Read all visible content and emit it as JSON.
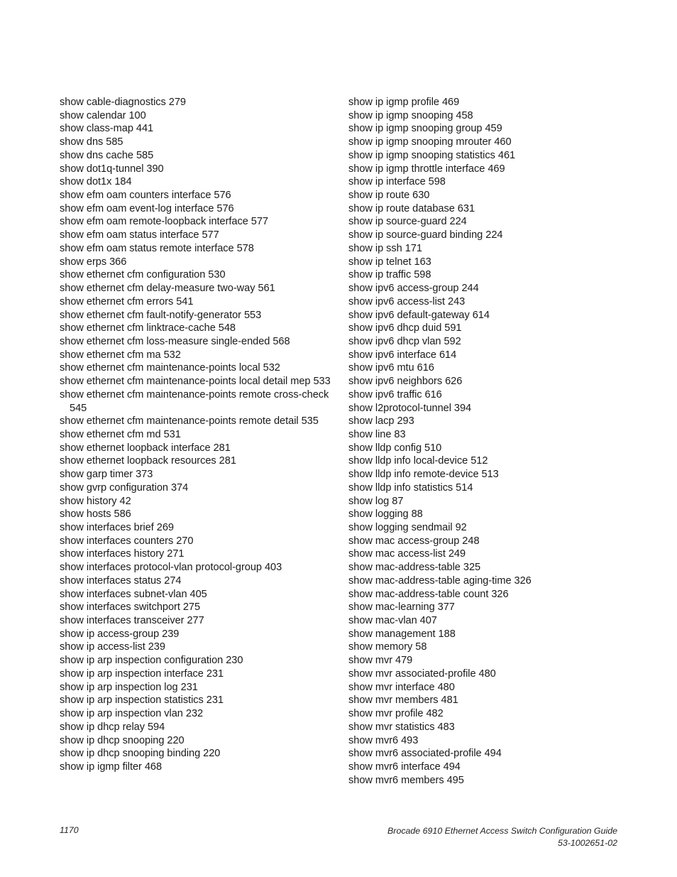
{
  "index": {
    "left_column": [
      "show cable-diagnostics 279",
      "show calendar 100",
      "show class-map 441",
      "show dns 585",
      "show dns cache 585",
      "show dot1q-tunnel 390",
      "show dot1x 184",
      "show efm oam counters interface  576",
      "show efm oam event-log interface  576",
      "show efm oam remote-loopback interface 577",
      "show efm oam status interface 577",
      "show efm oam status remote interface  578",
      "show erps 366",
      "show ethernet cfm configuration 530",
      "show ethernet cfm delay-measure two-way 561",
      "show ethernet cfm errors 541",
      "show ethernet cfm fault-notify-generator 553",
      "show ethernet cfm linktrace-cache 548",
      "show ethernet cfm loss-measure single-ended 568",
      "show ethernet cfm ma 532",
      "show ethernet cfm maintenance-points local 532",
      "show ethernet cfm maintenance-points local detail mep 533",
      "show ethernet cfm maintenance-points remote cross-check 545",
      "show ethernet cfm maintenance-points remote detail 535",
      "show ethernet cfm md 531",
      "show ethernet loopback interface 281",
      "show ethernet loopback resources 281",
      "show garp timer 373",
      "show gvrp configuration 374",
      "show history 42",
      "show hosts 586",
      "show interfaces brief 269",
      "show interfaces counters 270",
      "show interfaces history 271",
      "show interfaces protocol-vlan protocol-group 403",
      "show interfaces status 274",
      "show interfaces subnet-vlan 405",
      "show interfaces switchport 275",
      "show interfaces transceiver 277",
      "show ip access-group 239",
      "show ip access-list 239",
      "show ip arp inspection configuration 230",
      "show ip arp inspection interface 231",
      "show ip arp inspection log 231",
      "show ip arp inspection statistics 231",
      "show ip arp inspection vlan 232",
      "show ip dhcp relay 594",
      "show ip dhcp snooping 220",
      "show ip dhcp snooping binding 220",
      "show ip igmp filter 468"
    ],
    "right_column": [
      "show ip igmp profile 469",
      "show ip igmp snooping 458",
      "show ip igmp snooping group  459",
      "show ip igmp snooping mrouter 460",
      "show ip igmp snooping statistics 461",
      "show ip igmp throttle interface 469",
      "show ip interface 598",
      "show ip route 630",
      "show ip route database 631",
      "show ip source-guard 224",
      "show ip source-guard binding 224",
      "show ip ssh 171",
      "show ip telnet 163",
      "show ip traffic 598",
      "show ipv6 access-group 244",
      "show ipv6 access-list 243",
      "show ipv6 default-gateway 614",
      "show ipv6 dhcp duid 591",
      "show ipv6 dhcp vlan 592",
      "show ipv6 interface 614",
      "show ipv6 mtu 616",
      "show ipv6 neighbors 626",
      "show ipv6 traffic 616",
      "show l2protocol-tunnel 394",
      "show lacp 293",
      "show line 83",
      "show lldp config 510",
      "show lldp info local-device 512",
      "show lldp info remote-device 513",
      "show lldp info statistics 514",
      "show log 87",
      "show logging 88",
      "show logging sendmail 92",
      "show mac access-group 248",
      "show mac access-list 249",
      "show mac-address-table 325",
      "show mac-address-table aging-time 326",
      "show mac-address-table count 326",
      "show mac-learning 377",
      "show mac-vlan 407",
      "show management 188",
      "show memory 58",
      "show mvr 479",
      "show mvr associated-profile 480",
      "show mvr interface 480",
      "show mvr members 481",
      "show mvr profile 482",
      "show mvr statistics 483",
      "show mvr6 493",
      "show mvr6 associated-profile 494",
      "show mvr6 interface 494",
      "show mvr6 members 495"
    ]
  },
  "footer": {
    "page_number": "1170",
    "doc_title": "Brocade 6910 Ethernet Access Switch Configuration Guide",
    "doc_number": "53-1002651-02"
  }
}
